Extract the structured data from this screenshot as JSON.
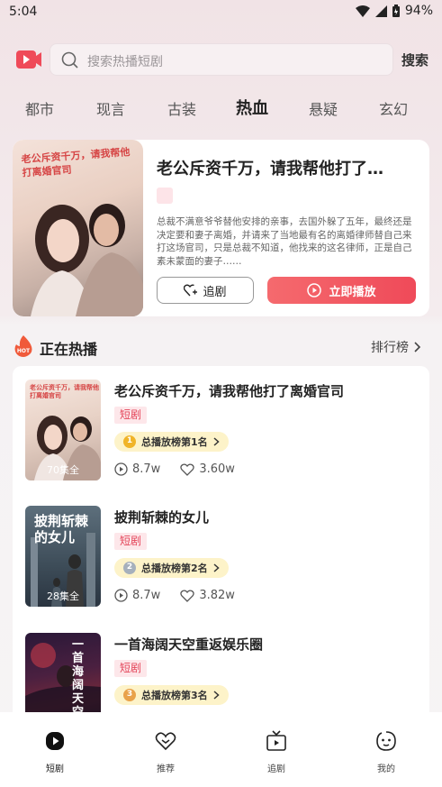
{
  "status_bar": {
    "time": "5:04",
    "battery": "94%"
  },
  "search": {
    "placeholder": "搜索热播短剧",
    "button": "搜索"
  },
  "categories": [
    "都市",
    "现言",
    "古装",
    "热血",
    "悬疑",
    "玄幻"
  ],
  "active_category": "热血",
  "featured": {
    "poster_text": "老公斥资千万，请我帮他打离婚官司",
    "title": "老公斥资千万，请我帮他打了…",
    "description": "总裁不满意爷爷替他安排的亲事，去国外躲了五年，最终还是决定要和妻子离婚，并请来了当地最有名的离婚律师替自己来打这场官司，只是总裁不知道，他找来的这名律师，正是自己素未蒙面的妻子……",
    "follow_label": "追剧",
    "play_label": "立即播放"
  },
  "section": {
    "title": "正在热播",
    "rank_link": "排行榜",
    "hot_badge": "HOT"
  },
  "list": [
    {
      "title": "老公斥资千万，请我帮他打了离婚官司",
      "poster_text": "老公斥资千万，请我帮他打离婚官司",
      "episodes": "70集全",
      "tag": "短剧",
      "rank": "总播放榜第1名",
      "rank_num": "1",
      "plays": "8.7w",
      "likes": "3.60w"
    },
    {
      "title": "披荆斩棘的女儿",
      "poster_text": "披荆斩棘的女儿",
      "episodes": "28集全",
      "tag": "短剧",
      "rank": "总播放榜第2名",
      "rank_num": "2",
      "plays": "8.7w",
      "likes": "3.82w"
    },
    {
      "title": "一首海阔天空重返娱乐圈",
      "poster_text": "一首海阔天空重返娱乐圈",
      "episodes": "",
      "tag": "短剧",
      "rank": "总播放榜第3名",
      "rank_num": "3",
      "plays": "",
      "likes": ""
    }
  ],
  "bottom_nav": [
    {
      "label": "短剧",
      "icon": "play-circle-icon",
      "active": true
    },
    {
      "label": "推荐",
      "icon": "heart-badge-icon",
      "active": false
    },
    {
      "label": "追剧",
      "icon": "tv-icon",
      "active": false
    },
    {
      "label": "我的",
      "icon": "face-icon",
      "active": false
    }
  ],
  "colors": {
    "accent": "#ef4a59",
    "tag_bg": "#fde7ea",
    "rank_bg": "#fdf3c9"
  }
}
